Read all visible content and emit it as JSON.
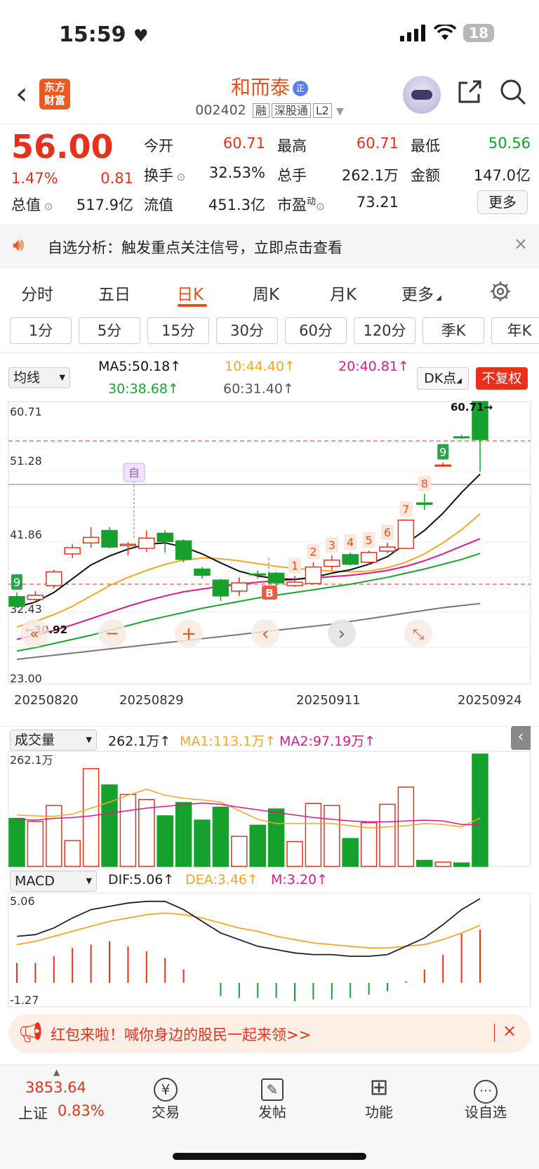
{
  "status_bar": {
    "time": "15:59",
    "heart": "♥",
    "battery": "18",
    "signal_icon": "signal-icon",
    "wifi_icon": "wifi-icon"
  },
  "header": {
    "back_icon": "‹",
    "logo_line1": "东方",
    "logo_line2": "财富",
    "stock_name": "和而泰",
    "badge": "正",
    "stock_code": "002402",
    "tags": [
      "融",
      "深股通",
      "L2"
    ]
  },
  "quote": {
    "price": "56.00",
    "change_pct": "1.47%",
    "change_amt": "0.81",
    "rows": [
      [
        {
          "label": "今开",
          "value": "60.71",
          "color": "red"
        },
        {
          "label": "最高",
          "value": "60.71",
          "color": "red"
        },
        {
          "label": "最低",
          "value": "50.56",
          "color": "green"
        }
      ],
      [
        {
          "label": "换手",
          "value": "32.53%",
          "color": "dark"
        },
        {
          "label": "总手",
          "value": "262.1万",
          "color": "dark"
        },
        {
          "label": "金额",
          "value": "147.0亿",
          "color": "dark"
        }
      ]
    ],
    "mkt_cap_label": "总值",
    "mkt_cap": "517.9亿",
    "float_label": "流值",
    "float_cap": "451.3亿",
    "pe_label": "市盈",
    "pe_sup": "动",
    "pe": "73.21",
    "more": "更多"
  },
  "notice": {
    "text": "自选分析：触发重点关注信号，立即点击查看",
    "close": "×"
  },
  "period_tabs": [
    "分时",
    "五日",
    "日K",
    "周K",
    "月K",
    "更多"
  ],
  "active_tab": "日K",
  "minute_buttons": [
    "1分",
    "5分",
    "15分",
    "30分",
    "60分",
    "120分",
    "季K",
    "年K"
  ],
  "ma_bar": {
    "select": "均线",
    "ma5": "MA5:50.18↑",
    "ma10": "10:44.40↑",
    "ma20": "20:40.81↑",
    "ma30": "30:38.68↑",
    "ma60": "60:31.40↑",
    "dk": "DK点",
    "fq": "不复权"
  },
  "kline": {
    "y_labels": [
      "60.71",
      "51.28",
      "41.86",
      "32.43",
      "23.00"
    ],
    "x_labels": [
      "20250820",
      "20250829",
      "20250911",
      "20250924"
    ],
    "high_mark": "60.71→",
    "low_mark": "←30.92",
    "signal_b": "B",
    "signal_zi": "自",
    "tags": [
      "9",
      "1",
      "2",
      "3",
      "4",
      "5",
      "6",
      "7",
      "8",
      "9"
    ],
    "nav_icons": [
      "«",
      "−",
      "+",
      "‹",
      "›",
      "⤡"
    ]
  },
  "chart_data": {
    "type": "candlestick",
    "y_range": [
      23.0,
      60.71
    ],
    "candles": [
      {
        "o": 32.4,
        "c": 31.0,
        "h": 33.0,
        "l": 30.92
      },
      {
        "o": 32.0,
        "c": 32.6,
        "h": 33.2,
        "l": 31.5
      },
      {
        "o": 34.0,
        "c": 36.0,
        "h": 36.3,
        "l": 33.6
      },
      {
        "o": 38.6,
        "c": 39.5,
        "h": 40.0,
        "l": 38.0
      },
      {
        "o": 40.2,
        "c": 41.0,
        "h": 42.5,
        "l": 39.5
      },
      {
        "o": 42.0,
        "c": 39.6,
        "h": 42.5,
        "l": 39.4
      },
      {
        "o": 39.8,
        "c": 40.0,
        "h": 40.3,
        "l": 38.4
      },
      {
        "o": 39.4,
        "c": 40.9,
        "h": 42.0,
        "l": 38.9
      },
      {
        "o": 41.6,
        "c": 40.4,
        "h": 42.0,
        "l": 38.8
      },
      {
        "o": 40.5,
        "c": 37.8,
        "h": 40.7,
        "l": 37.4
      },
      {
        "o": 36.4,
        "c": 35.5,
        "h": 36.7,
        "l": 35.0
      },
      {
        "o": 34.8,
        "c": 32.5,
        "h": 35.0,
        "l": 31.8
      },
      {
        "o": 33.2,
        "c": 34.4,
        "h": 35.2,
        "l": 32.5
      },
      {
        "o": 35.7,
        "c": 35.6,
        "h": 36.2,
        "l": 35.0
      },
      {
        "o": 35.8,
        "c": 34.4,
        "h": 36.0,
        "l": 34.0
      },
      {
        "o": 34.0,
        "c": 34.5,
        "h": 35.4,
        "l": 33.8
      },
      {
        "o": 34.3,
        "c": 36.7,
        "h": 37.4,
        "l": 34.2
      },
      {
        "o": 36.8,
        "c": 37.7,
        "h": 38.4,
        "l": 36.2
      },
      {
        "o": 38.5,
        "c": 37.1,
        "h": 38.8,
        "l": 36.9
      },
      {
        "o": 37.4,
        "c": 38.8,
        "h": 39.1,
        "l": 37.0
      },
      {
        "o": 39.0,
        "c": 39.6,
        "h": 40.2,
        "l": 38.7
      },
      {
        "o": 39.4,
        "c": 43.5,
        "h": 43.6,
        "l": 39.3
      },
      {
        "o": 46.0,
        "c": 45.8,
        "h": 47.3,
        "l": 45.0
      },
      {
        "o": 51.4,
        "c": 51.5,
        "h": 51.9,
        "l": 51.4
      },
      {
        "o": 55.6,
        "c": 55.5,
        "h": 55.9,
        "l": 55.3
      },
      {
        "o": 60.71,
        "c": 55.2,
        "h": 60.71,
        "l": 50.56
      }
    ],
    "ma5": [
      30.9,
      31.6,
      33.0,
      35.0,
      37.0,
      38.3,
      39.3,
      40.0,
      40.2,
      39.6,
      38.6,
      37.3,
      36.1,
      35.4,
      35.0,
      34.9,
      35.2,
      35.8,
      36.3,
      37.1,
      38.2,
      40.1,
      42.0,
      44.5,
      47.5,
      50.18
    ],
    "ma10": [
      28.0,
      28.8,
      29.8,
      31.0,
      32.5,
      34.0,
      35.2,
      36.2,
      37.1,
      37.7,
      38.0,
      37.9,
      37.6,
      37.2,
      36.8,
      36.5,
      36.3,
      36.1,
      36.0,
      36.1,
      36.6,
      37.4,
      38.6,
      40.2,
      42.1,
      44.4
    ],
    "ma20": [
      26.2,
      26.8,
      27.5,
      28.3,
      29.2,
      30.1,
      31.0,
      31.8,
      32.5,
      33.1,
      33.5,
      33.9,
      34.2,
      34.5,
      34.7,
      34.9,
      35.1,
      35.3,
      35.5,
      35.8,
      36.2,
      36.8,
      37.6,
      38.6,
      39.7,
      40.81
    ],
    "ma30": [
      24.5,
      25.0,
      25.6,
      26.2,
      26.8,
      27.5,
      28.2,
      28.9,
      29.5,
      30.1,
      30.7,
      31.2,
      31.7,
      32.2,
      32.6,
      33.0,
      33.4,
      33.8,
      34.2,
      34.7,
      35.2,
      35.8,
      36.4,
      37.1,
      37.8,
      38.68
    ],
    "ma60": [
      23.3,
      23.6,
      23.9,
      24.2,
      24.5,
      24.8,
      25.1,
      25.4,
      25.7,
      26.0,
      26.3,
      26.6,
      26.9,
      27.2,
      27.5,
      27.8,
      28.1,
      28.4,
      28.8,
      29.2,
      29.6,
      30.0,
      30.4,
      30.8,
      31.1,
      31.4
    ],
    "volume": {
      "max": 262.1,
      "values": [
        112,
        105,
        142,
        60,
        228,
        190,
        168,
        156,
        118,
        149,
        108,
        138,
        70,
        96,
        134,
        58,
        147,
        142,
        65,
        102,
        145,
        185,
        14,
        10,
        8,
        262.1
      ],
      "ma1": [
        120,
        118,
        117,
        122,
        136,
        150,
        166,
        180,
        166,
        159,
        155,
        150,
        130,
        110,
        100,
        100,
        100,
        100,
        95,
        90,
        92,
        95,
        100,
        98,
        92,
        113.1
      ],
      "ma2": [
        110,
        108,
        112,
        114,
        118,
        124,
        130,
        136,
        140,
        144,
        148,
        145,
        138,
        132,
        126,
        120,
        114,
        110,
        106,
        104,
        104,
        106,
        108,
        106,
        98,
        97.19
      ]
    },
    "macd": {
      "range": [
        -1.27,
        5.06
      ],
      "dif": [
        2.8,
        2.9,
        3.3,
        3.9,
        4.4,
        4.6,
        4.8,
        4.9,
        4.9,
        4.4,
        3.7,
        3.0,
        2.6,
        2.2,
        2.0,
        1.8,
        1.7,
        1.7,
        1.6,
        1.6,
        1.7,
        2.2,
        2.7,
        3.5,
        4.4,
        5.06
      ],
      "dea": [
        2.3,
        2.5,
        2.8,
        3.1,
        3.4,
        3.7,
        3.9,
        4.1,
        4.2,
        4.1,
        3.9,
        3.6,
        3.3,
        3.1,
        2.8,
        2.6,
        2.4,
        2.3,
        2.2,
        2.1,
        2.1,
        2.2,
        2.3,
        2.6,
        3.0,
        3.46
      ],
      "m": [
        1.2,
        1.2,
        1.6,
        2.1,
        2.3,
        2.5,
        2.2,
        1.9,
        1.5,
        0.8,
        0.0,
        -0.8,
        -0.9,
        -0.9,
        -0.9,
        -1.1,
        -1.0,
        -1.0,
        -0.9,
        -0.7,
        -0.5,
        0.1,
        0.8,
        1.7,
        3.0,
        3.2
      ]
    }
  },
  "volume_bar": {
    "select": "成交量",
    "total": "262.1万↑",
    "ma1": "MA1:113.1万↑",
    "ma2": "MA2:97.19万↑",
    "y_label": "262.1万"
  },
  "macd_bar": {
    "select": "MACD",
    "dif": "DIF:5.06↑",
    "dea": "DEA:3.46↑",
    "m": "M:3.20↑",
    "y_top": "5.06",
    "y_bottom": "-1.27"
  },
  "banner": {
    "text": "红包来啦！喊你身边的股民一起来领>>",
    "close": "×"
  },
  "bottom_nav": {
    "index_value": "3853.64",
    "index_name": "上证",
    "index_pct": "0.83%",
    "items": [
      {
        "label": "交易",
        "icon": "trade-icon",
        "glyph": "¥"
      },
      {
        "label": "发帖",
        "icon": "post-icon",
        "glyph": "✎"
      },
      {
        "label": "功能",
        "icon": "function-icon",
        "glyph": "⊞"
      },
      {
        "label": "设自选",
        "icon": "add-watchlist-icon",
        "glyph": "⋯"
      }
    ]
  },
  "colors": {
    "up": "#e8311a",
    "down": "#16a02c",
    "accent": "#e8531e"
  }
}
